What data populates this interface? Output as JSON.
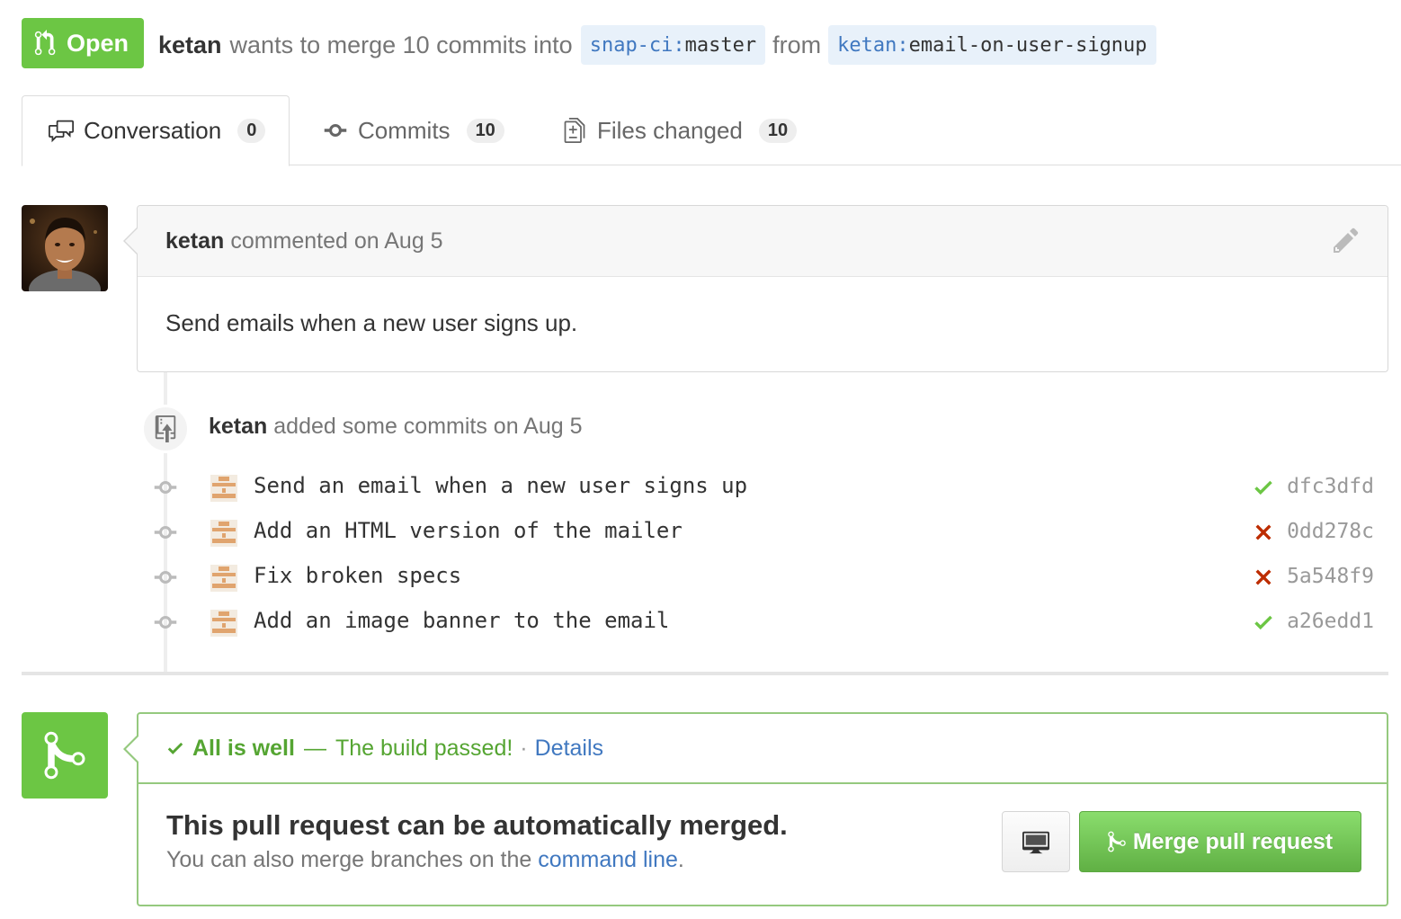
{
  "header": {
    "state_label": "Open",
    "author": "ketan",
    "merge_text": "wants to merge 10 commits into",
    "base_repo": "snap-ci",
    "base_branch": "master",
    "from_text": "from",
    "head_repo": "ketan",
    "head_branch": "email-on-user-signup"
  },
  "tabs": [
    {
      "label": "Conversation",
      "count": "0",
      "icon": "comment-discussion-icon"
    },
    {
      "label": "Commits",
      "count": "10",
      "icon": "git-commit-icon"
    },
    {
      "label": "Files changed",
      "count": "10",
      "icon": "diff-icon"
    }
  ],
  "comment": {
    "author": "ketan",
    "action": "commented on Aug 5",
    "body": "Send emails when a new user signs up."
  },
  "commit_event": {
    "author": "ketan",
    "action": "added some commits on Aug 5",
    "commits": [
      {
        "message": "Send an email when a new user signs up",
        "sha": "dfc3dfd",
        "status": "success"
      },
      {
        "message": "Add an HTML version of the mailer",
        "sha": "0dd278c",
        "status": "failure"
      },
      {
        "message": "Fix broken specs",
        "sha": "5a548f9",
        "status": "failure"
      },
      {
        "message": "Add an image banner to the email",
        "sha": "a26edd1",
        "status": "success"
      }
    ]
  },
  "merge": {
    "status_title": "All is well",
    "status_dash": "—",
    "status_desc": "The build passed!",
    "status_dot": "·",
    "details_link": "Details",
    "title": "This pull request can be automatically merged.",
    "sub_prefix": "You can also merge branches on the",
    "sub_link": "command line",
    "sub_suffix": ".",
    "button_label": "Merge pull request"
  },
  "colors": {
    "open_green": "#6cc644",
    "success_green": "#55a532",
    "failure_red": "#bd2c00",
    "link_blue": "#4078c0"
  }
}
